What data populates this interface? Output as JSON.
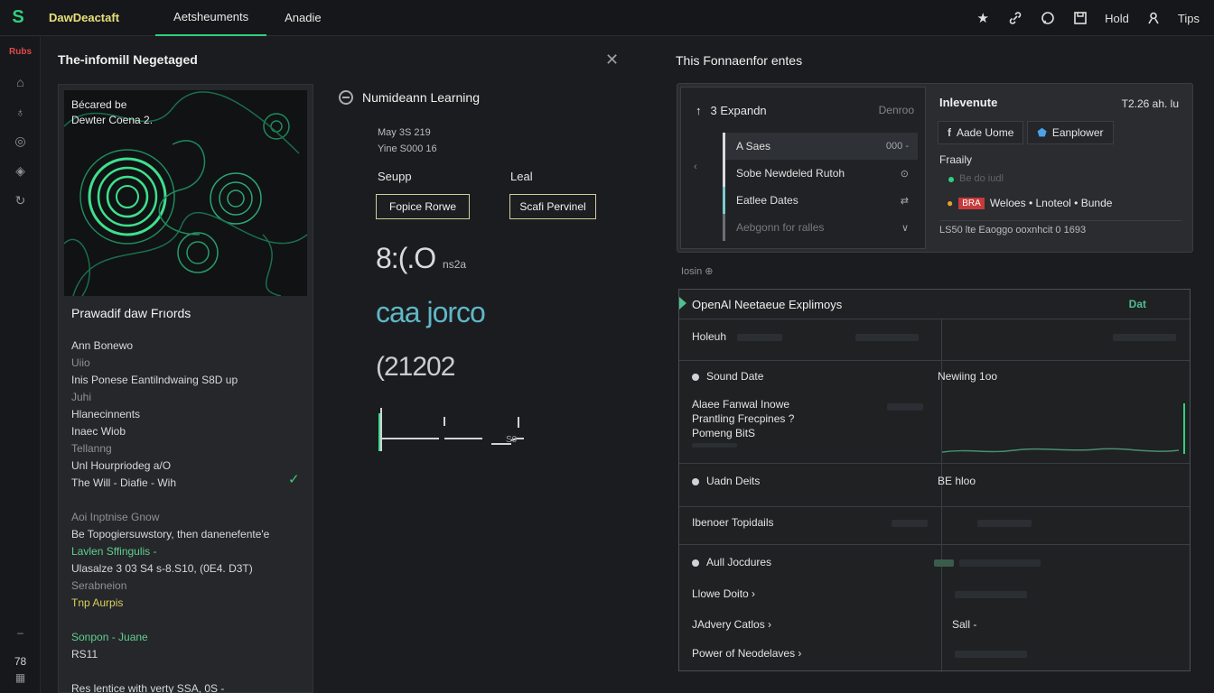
{
  "topbar": {
    "logo": "S",
    "brand": "DawDeactaft",
    "tabs": [
      "Aetsheuments",
      "Anadie"
    ],
    "right_icons": [
      "star-icon",
      "link-icon",
      "chat-icon"
    ],
    "hold_label": "Hold",
    "tips_label": "Tips"
  },
  "rail": {
    "badge": "Rubs",
    "items": [
      "home-icon",
      "bulb-icon",
      "globe-icon",
      "layers-icon",
      "refresh-icon"
    ],
    "bottom_number": "78"
  },
  "dialog": {
    "title": "The-infomill Negetaged",
    "card": {
      "art_caption_line1": "Bécared be",
      "art_caption_line2": "Dewter Coena 2.",
      "subtitle": "Prawadif daw Frıords",
      "lines": [
        {
          "text": "Ann Bonewo",
          "style": ""
        },
        {
          "text": "Uiio",
          "style": "dim"
        },
        {
          "text": "Inis Ponese Eantilndwaing S8D up",
          "style": ""
        },
        {
          "text": "Juhi",
          "style": "dim"
        },
        {
          "text": "Hlanecinnents",
          "style": ""
        },
        {
          "text": "Inaec Wiob",
          "style": ""
        },
        {
          "text": "Tellanng",
          "style": "dim"
        },
        {
          "text": "Unl Hourpriodeg a/O",
          "style": ""
        },
        {
          "text": "The Will - Diafie - Wih",
          "style": ""
        },
        {
          "text": "",
          "style": ""
        },
        {
          "text": "Aoi Inptnise Gnow",
          "style": "dim"
        },
        {
          "text": "Be Topogiersuwstory, then danenefente'e",
          "style": ""
        },
        {
          "text": "Lavlen Sffingulis -",
          "style": "green"
        },
        {
          "text": "Ulasalze 3 03 S4 s-8.S10, (0E4. D3T)",
          "style": ""
        },
        {
          "text": "Serabneion",
          "style": "dim"
        },
        {
          "text": "Tnp Aurpis",
          "style": "yellow"
        },
        {
          "text": "",
          "style": ""
        },
        {
          "text": "Sonpon - Juane",
          "style": "green"
        },
        {
          "text": "RS11",
          "style": ""
        },
        {
          "text": "",
          "style": ""
        },
        {
          "text": "Res lentice with verty SSA, 0S -",
          "style": ""
        }
      ]
    }
  },
  "middle": {
    "heading": "Numideann Learning",
    "meta_line1": "May 3S 219",
    "meta_line2": "Yine S000 16",
    "label_left": "Seupp",
    "label_right": "Leal",
    "button_left": "Fopice Rorwe",
    "button_right": "Scafi Pervinel",
    "big_value_1": "8:(.O",
    "big_value_1_suffix": "ns2a",
    "big_value_2": "caa jorco",
    "big_value_3": "(21202",
    "spark_label": "S0"
  },
  "right_top": {
    "title": "This Fonnaenfor entes",
    "list": {
      "header": "3 Expandn",
      "header_right": "Denroo",
      "rows": [
        {
          "label": "A Saes",
          "end": "000 -",
          "kind": "sel"
        },
        {
          "label": "Sobe Newdeled Rutoh",
          "end": "⊙",
          "kind": ""
        },
        {
          "label": "Eatlee Dates",
          "end": "⇄",
          "kind": "cyan"
        },
        {
          "label": "Aebgonn for ralles",
          "end": "∨",
          "kind": "dim"
        }
      ]
    },
    "info": {
      "title": "Inlevenute",
      "time": "T2.26 ah. lu",
      "chip1": "Aade Uome",
      "chip2": "Eanplower",
      "family_label": "Fraaily",
      "faint_line": "Be do iudl",
      "row_tag": "BRA",
      "row_text": "Weloes • Lnoteol • Bunde",
      "footer": "LS50 lte Eaoggo ooxnhcit 0 1693"
    }
  },
  "logs_label": "Iosin ⊕",
  "table": {
    "header": "OpenAl Neetaeue Explimoys",
    "action": "Dat",
    "rows": [
      {
        "left": "Holeuh",
        "right": ""
      },
      {
        "left": "Sound Date",
        "right": "Newiing 1oo"
      },
      {
        "left": "Alaee Fanwal Inowe",
        "right": ""
      },
      {
        "left": "Prantling Frecpines ?",
        "right": ""
      },
      {
        "left": "Pomeng BitS",
        "right": ""
      },
      {
        "left": "Uadn Deits",
        "right": "BE hloo"
      },
      {
        "left": "Ibenoer Topidails",
        "right": ""
      },
      {
        "left": "Aull Jocdures",
        "right": ""
      },
      {
        "left": "Llowe Doito ›",
        "right": ""
      },
      {
        "left": "JAdvery Catlos ›",
        "right": "Sall -"
      },
      {
        "left": "Power of Neodelaves ›",
        "right": ""
      }
    ]
  },
  "colors": {
    "accent": "#2fd07e",
    "brand": "#e6e07a",
    "teal": "#5fb7c7",
    "danger": "#c63a3a"
  }
}
